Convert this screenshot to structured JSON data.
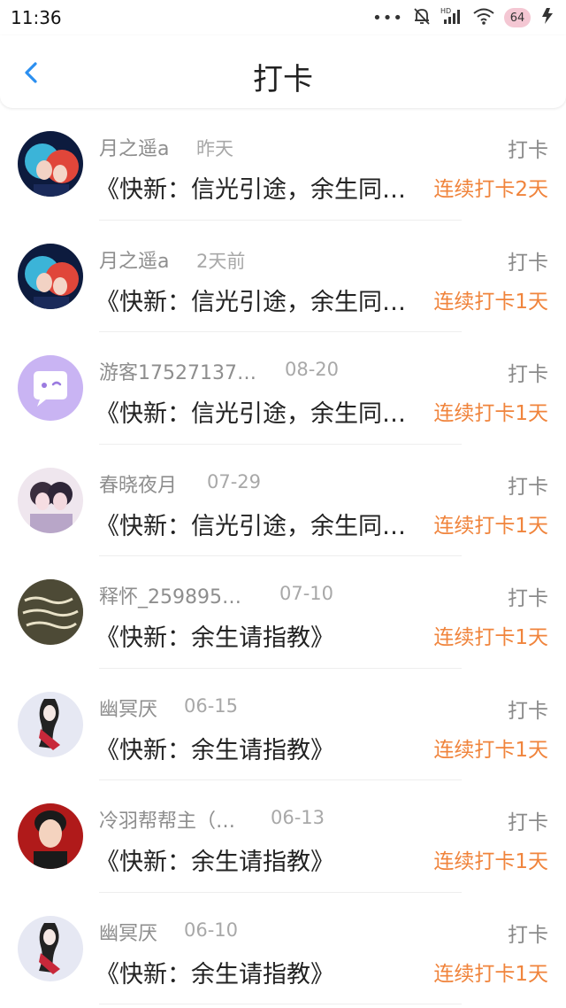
{
  "status_bar": {
    "time": "11:36",
    "battery": "64",
    "icons": [
      "more-dots-icon",
      "bell-off-icon",
      "hd-signal-icon",
      "wifi-icon",
      "battery-icon",
      "charging-icon"
    ]
  },
  "header": {
    "title": "打卡",
    "back_icon": "chevron-left-icon",
    "accent": "#2b8ff0"
  },
  "colors": {
    "streak": "#f0843c",
    "muted": "#8e8e8e"
  },
  "items": [
    {
      "user": "月之遥a",
      "time": "昨天",
      "action": "打卡",
      "book": "《快新：信光引途，余生同…",
      "streak": "连续打卡2天",
      "avatar": "anime-couple-avatar"
    },
    {
      "user": "月之遥a",
      "time": "2天前",
      "action": "打卡",
      "book": "《快新：信光引途，余生同…",
      "streak": "连续打卡1天",
      "avatar": "anime-couple-avatar"
    },
    {
      "user": "游客17527137…",
      "time": "08-20",
      "action": "打卡",
      "book": "《快新：信光引途，余生同…",
      "streak": "连续打卡1天",
      "avatar": "chat-bubble-avatar"
    },
    {
      "user": "春晓夜月",
      "time": "07-29",
      "action": "打卡",
      "book": "《快新：信光引途，余生同…",
      "streak": "连续打卡1天",
      "avatar": "anime-pair-avatar"
    },
    {
      "user": "释怀_259895…",
      "time": "07-10",
      "action": "打卡",
      "book": "《快新：余生请指教》",
      "streak": "连续打卡1天",
      "avatar": "handwriting-avatar"
    },
    {
      "user": "幽冥厌",
      "time": "06-15",
      "action": "打卡",
      "book": "《快新：余生请指教》",
      "streak": "连续打卡1天",
      "avatar": "ink-character-avatar"
    },
    {
      "user": "冷羽帮帮主（…",
      "time": "06-13",
      "action": "打卡",
      "book": "《快新：余生请指教》",
      "streak": "连续打卡1天",
      "avatar": "portrait-avatar"
    },
    {
      "user": "幽冥厌",
      "time": "06-10",
      "action": "打卡",
      "book": "《快新：余生请指教》",
      "streak": "连续打卡1天",
      "avatar": "ink-character-avatar"
    }
  ]
}
